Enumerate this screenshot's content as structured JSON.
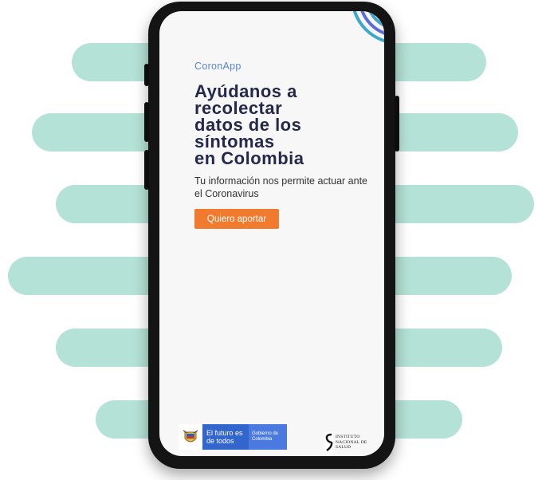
{
  "app": {
    "name": "CoronApp",
    "headline": "Ayúdanos a\nrecolectar\ndatos de los\nsíntomas\nen Colombia",
    "subtitle": "Tu información nos permite actuar ante el Coronavirus",
    "cta_label": "Quiero aportar"
  },
  "footer": {
    "gov_left": "El futuro es de todos",
    "gov_right": "Gobierno de Colombia",
    "ins_line1": "INSTITUTO",
    "ins_line2": "NACIONAL DE",
    "ins_line3": "SALUD"
  },
  "colors": {
    "accent": "#f07b2e",
    "brand_blue": "#5b84d6",
    "headline": "#24284a",
    "background_shapes": "#b5e2d6"
  },
  "icons": [
    "coronapp-logo-icon",
    "colombia-crest-icon",
    "ins-logo-icon"
  ]
}
